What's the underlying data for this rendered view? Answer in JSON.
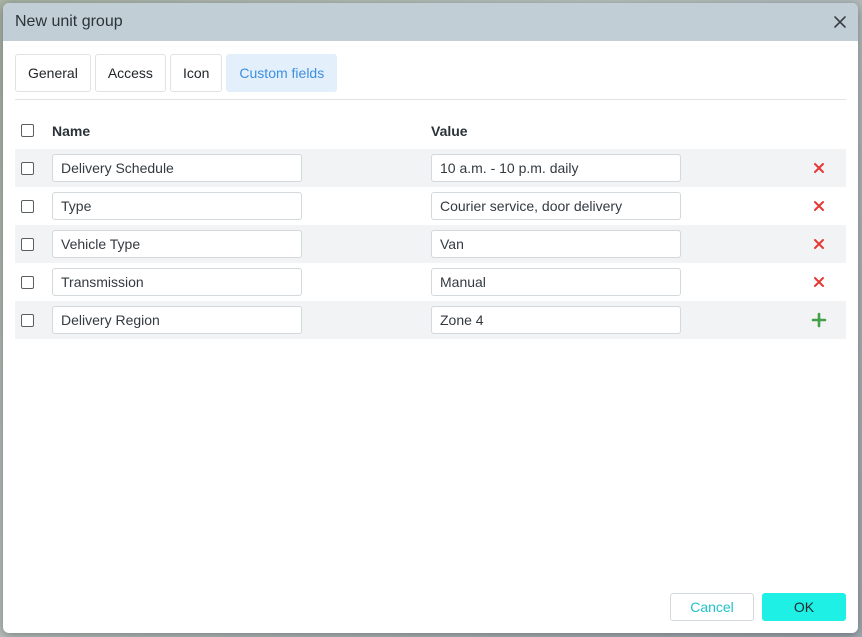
{
  "dialog": {
    "title": "New unit group"
  },
  "tabs": [
    {
      "label": "General",
      "active": false
    },
    {
      "label": "Access",
      "active": false
    },
    {
      "label": "Icon",
      "active": false
    },
    {
      "label": "Custom fields",
      "active": true
    }
  ],
  "table": {
    "headers": {
      "name": "Name",
      "value": "Value"
    },
    "rows": [
      {
        "name": "Delivery Schedule",
        "value": "10 a.m. - 10 p.m. daily",
        "action": "delete"
      },
      {
        "name": "Type",
        "value": "Courier service, door delivery",
        "action": "delete"
      },
      {
        "name": "Vehicle Type",
        "value": "Van",
        "action": "delete"
      },
      {
        "name": "Transmission",
        "value": "Manual",
        "action": "delete"
      },
      {
        "name": "Delivery Region",
        "value": "Zone 4",
        "action": "add"
      }
    ]
  },
  "footer": {
    "cancel_label": "Cancel",
    "ok_label": "OK"
  },
  "colors": {
    "titlebar": "#c2ced6",
    "active_tab_bg": "#e3f0fb",
    "active_tab_text": "#3d8fe0",
    "delete_icon": "#e53935",
    "add_icon": "#43a047",
    "ok_button": "#1ef0e6",
    "cancel_text": "#1fc3c9"
  },
  "icons": {
    "close": "close-icon",
    "delete": "delete-icon",
    "add": "add-icon"
  }
}
